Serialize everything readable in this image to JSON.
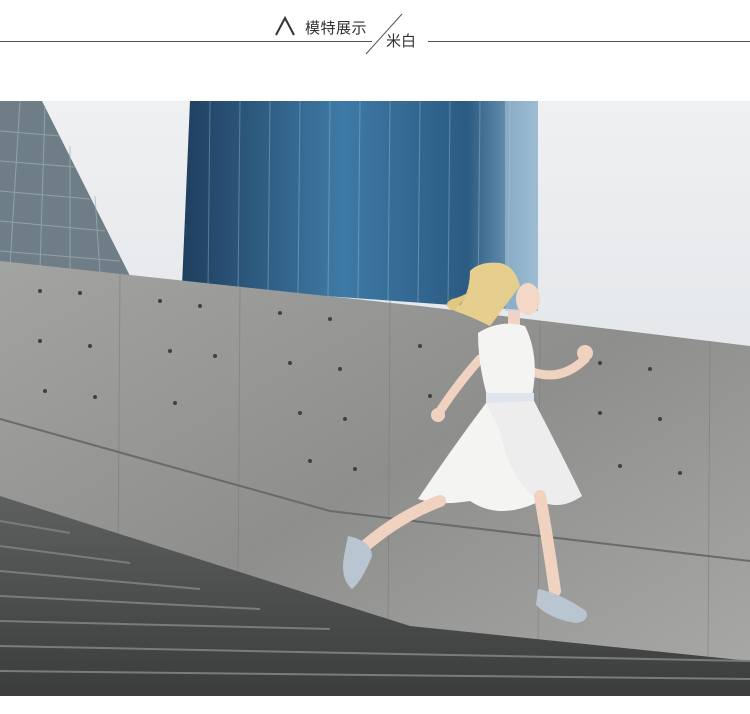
{
  "header": {
    "title": "模特展示",
    "subtitle": "米白"
  },
  "photo": {
    "icon": "model-photo",
    "sky_color": "#e4e7ea",
    "wall_color": "#9a9a98",
    "tower_color": "#2f5f86",
    "dress_color": "#f4f4f2"
  }
}
